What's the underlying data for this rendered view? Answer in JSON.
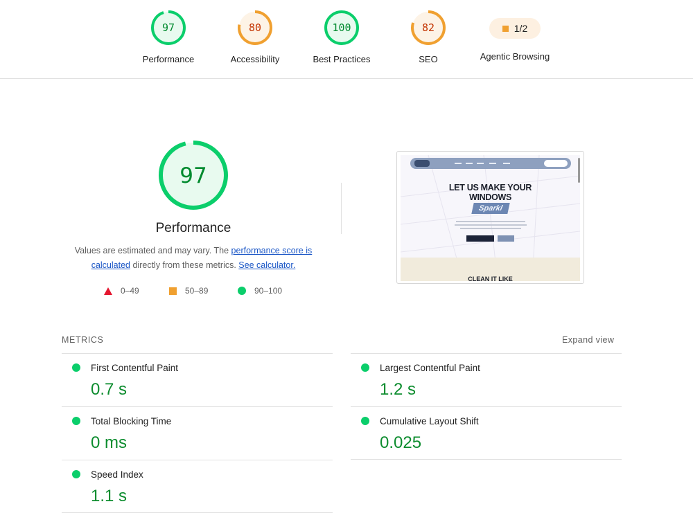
{
  "top_gauges": [
    {
      "label": "Performance",
      "score": "97",
      "color": "#0bce6b",
      "text_color": "#008a2e",
      "fill": "#e8faef"
    },
    {
      "label": "Accessibility",
      "score": "80",
      "color": "#f0a030",
      "text_color": "#c33300",
      "fill": "#fdf3e6"
    },
    {
      "label": "Best Practices",
      "score": "100",
      "color": "#0bce6b",
      "text_color": "#008a2e",
      "fill": "#e8faef"
    },
    {
      "label": "SEO",
      "score": "82",
      "color": "#f0a030",
      "text_color": "#c33300",
      "fill": "#fdf3e6"
    }
  ],
  "agentic": {
    "label": "Agentic Browsing",
    "fraction": "1/2",
    "color": "#f0a030"
  },
  "main": {
    "score": "97",
    "title": "Performance",
    "desc_part1": "Values are estimated and may vary. The ",
    "desc_link1": "performance score is calculated",
    "desc_part2": " directly from these metrics. ",
    "desc_link2": "See calculator."
  },
  "legend": [
    {
      "shape": "triangle",
      "range": "0–49",
      "color": "#e4162f"
    },
    {
      "shape": "square",
      "range": "50–89",
      "color": "#f0a030"
    },
    {
      "shape": "circle",
      "range": "90–100",
      "color": "#0bce6b"
    }
  ],
  "thumbnail": {
    "heading_line1": "LET US MAKE YOUR",
    "heading_line2": "WINDOWS",
    "badge": "Sparkl",
    "section_heading": "CLEAN IT LIKE"
  },
  "metrics": {
    "header": "METRICS",
    "expand_label": "Expand view",
    "items": [
      {
        "title": "First Contentful Paint",
        "value": "0.7 s"
      },
      {
        "title": "Largest Contentful Paint",
        "value": "1.2 s"
      },
      {
        "title": "Total Blocking Time",
        "value": "0 ms"
      },
      {
        "title": "Cumulative Layout Shift",
        "value": "0.025"
      },
      {
        "title": "Speed Index",
        "value": "1.1 s"
      }
    ]
  }
}
